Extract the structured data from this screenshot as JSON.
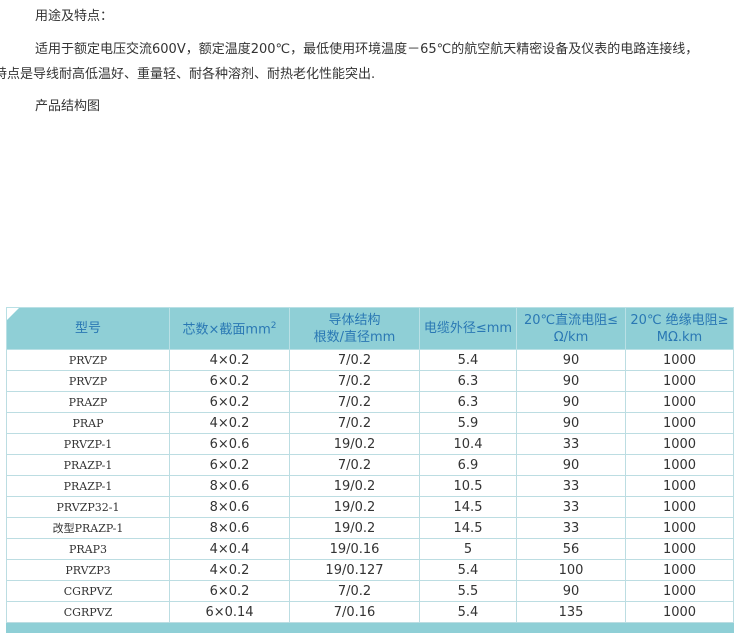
{
  "section_title": "用途及特点：",
  "paragraph_line1": "适用于额定电压交流600V，额定温度200℃，最低使用环境温度－65℃的航空航天精密设备及仪表的电路连接线，",
  "paragraph_line2": "其特点是导线耐高低温好、重量轻、耐各种溶剂、耐热老化性能突出.",
  "structure_caption": "产品结构图",
  "table": {
    "headers": {
      "model": "型号",
      "cores": "芯数×截面mm",
      "cores_sup": "2",
      "conductor_line1": "导体结构",
      "conductor_line2": "根数/直径mm",
      "outer_diameter": "电缆外径≤mm",
      "dc_res_line1": "20℃直流电阻≤",
      "dc_res_line2": "Ω/km",
      "ins_res_line1": "20℃ 绝缘电阻≥",
      "ins_res_line2": "MΩ.km"
    },
    "rows": [
      [
        "PRVZP",
        "4×0.2",
        "7/0.2",
        "5.4",
        "90",
        "1000"
      ],
      [
        "PRVZP",
        "6×0.2",
        "7/0.2",
        "6.3",
        "90",
        "1000"
      ],
      [
        "PRAZP",
        "6×0.2",
        "7/0.2",
        "6.3",
        "90",
        "1000"
      ],
      [
        "PRAP",
        "4×0.2",
        "7/0.2",
        "5.9",
        "90",
        "1000"
      ],
      [
        "PRVZP-1",
        "6×0.6",
        "19/0.2",
        "10.4",
        "33",
        "1000"
      ],
      [
        "PRAZP-1",
        "6×0.2",
        "7/0.2",
        "6.9",
        "90",
        "1000"
      ],
      [
        "PRAZP-1",
        "8×0.6",
        "19/0.2",
        "10.5",
        "33",
        "1000"
      ],
      [
        "PRVZP32-1",
        "8×0.6",
        "19/0.2",
        "14.5",
        "33",
        "1000"
      ],
      [
        "改型PRAZP-1",
        "8×0.6",
        "19/0.2",
        "14.5",
        "33",
        "1000"
      ],
      [
        "PRAP3",
        "4×0.4",
        "19/0.16",
        "5",
        "56",
        "1000"
      ],
      [
        "PRVZP3",
        "4×0.2",
        "19/0.127",
        "5.4",
        "100",
        "1000"
      ],
      [
        "CGRPVZ",
        "6×0.2",
        "7/0.2",
        "5.5",
        "90",
        "1000"
      ],
      [
        "CGRPVZ",
        "6×0.14",
        "7/0.16",
        "5.4",
        "135",
        "1000"
      ]
    ]
  },
  "colors": {
    "header_bg": "#8fcfd6",
    "header_text": "#2a78b4",
    "border": "#bcdde2"
  }
}
